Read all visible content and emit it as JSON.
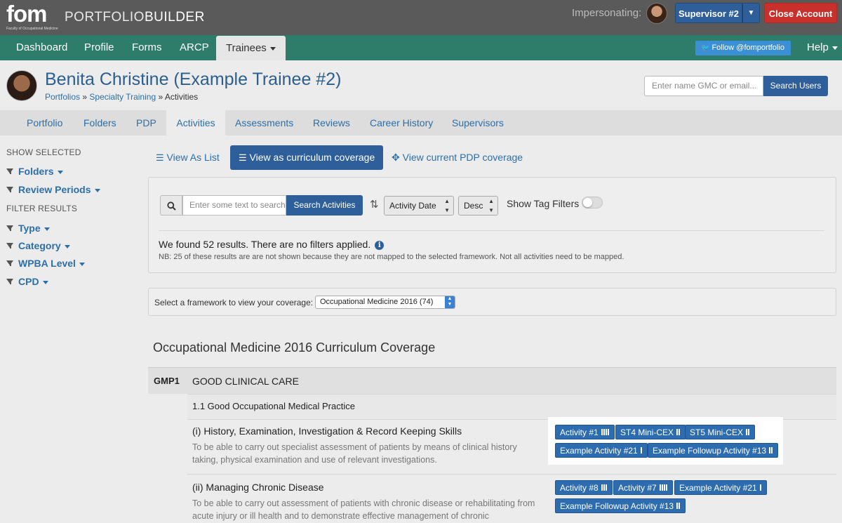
{
  "brand": {
    "logo": "fom",
    "logo_sub": "Faculty of Occupational Medicine",
    "name_light": "PORTFOLIO",
    "name_bold": "BUILDER"
  },
  "topbar": {
    "impersonating_label": "Impersonating:",
    "supervisor_label": "Supervisor #2",
    "close_account_label": "Close Account"
  },
  "nav": {
    "items": [
      "Dashboard",
      "Profile",
      "Forms",
      "ARCP",
      "Trainees"
    ],
    "follow_label": "Follow @fomportfolio",
    "help_label": "Help"
  },
  "user": {
    "name": "Benita Christine (Example Trainee #2)",
    "breadcrumb": [
      "Portfolios",
      "Specialty Training",
      "Activities"
    ],
    "breadcrumb_sep": "»"
  },
  "user_search": {
    "placeholder": "Enter name GMC or email...",
    "button_label": "Search Users"
  },
  "subtabs": [
    "Portfolio",
    "Folders",
    "PDP",
    "Activities",
    "Assessments",
    "Reviews",
    "Career History",
    "Supervisors"
  ],
  "sidebar": {
    "show_selected_heading": "SHOW SELECTED",
    "show_items": [
      "Folders",
      "Review Periods"
    ],
    "filter_heading": "FILTER RESULTS",
    "filter_items": [
      "Type",
      "Category",
      "WPBA Level",
      "CPD"
    ]
  },
  "views": {
    "list": "View As List",
    "curriculum": "View as curriculum coverage",
    "pdp": "View current PDP coverage"
  },
  "search": {
    "placeholder": "Enter some text to search",
    "button_label": "Search Activities",
    "sort_field": "Activity Date",
    "sort_order": "Desc",
    "tag_filters_label": "Show Tag Filters",
    "tag_filters_on": false
  },
  "results": {
    "summary": "We found 52 results. There are no filters applied.",
    "note": "NB: 25 of these results are are not shown because they are not mapped to the selected framework. Not all activities need to be mapped."
  },
  "framework": {
    "label": "Select a framework to view your coverage:",
    "selected": "Occupational Medicine 2016 (74)"
  },
  "coverage": {
    "title": "Occupational Medicine 2016 Curriculum Coverage",
    "domain_code": "GMP1",
    "domain_title": "GOOD CLINICAL CARE",
    "section_title": "1.1 Good Occupational Medical Practice",
    "items": [
      {
        "title": "(i) History, Examination, Investigation & Record Keeping Skills",
        "description": "To be able to carry out specialist assessment of patients by means of clinical history taking, physical examination and use of relevant investigations.",
        "tags": [
          {
            "label": "Activity #1",
            "level": 4
          },
          {
            "label": "ST4 Mini-CEX",
            "level": 2
          },
          {
            "label": "ST5 Mini-CEX",
            "level": 2
          },
          {
            "label": "Example Activity #21",
            "level": 1
          },
          {
            "label": "Example Followup Activity #13",
            "level": 2
          }
        ]
      },
      {
        "title": "(ii) Managing Chronic Disease",
        "description": "To be able to carry out assessment of patients with chronic disease or rehabilitating from acute injury or ill health and to demonstrate effective management of chronic",
        "tags": [
          {
            "label": "Activity #8",
            "level": 3
          },
          {
            "label": "Activity #7",
            "level": 4
          },
          {
            "label": "Example Activity #21",
            "level": 1
          },
          {
            "label": "Example Followup Activity #13",
            "level": 2
          }
        ]
      }
    ]
  },
  "colors": {
    "topbar": "#5a5a5a",
    "navbar": "#2e7d6b",
    "primary": "#2e5f9a",
    "danger": "#c9302c",
    "tag": "#2e6cb0"
  }
}
